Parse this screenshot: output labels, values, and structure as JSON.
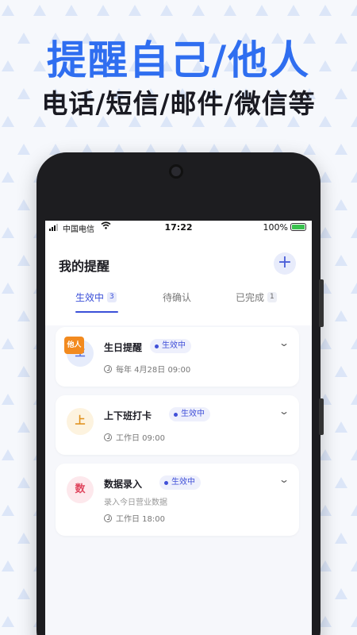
{
  "hero": {
    "title": "提醒自己/他人",
    "subtitle": "电话/短信/邮件/微信等"
  },
  "colors": {
    "accent": "#2f6ef0",
    "tab_active": "#3b50d8",
    "tag_orange": "#f28a1f"
  },
  "status_bar": {
    "carrier": "中国电信",
    "time": "17:22",
    "battery": "100%"
  },
  "page": {
    "title": "我的提醒",
    "add_icon": "plus-icon"
  },
  "tabs": [
    {
      "label": "生效中",
      "count": "3",
      "active": true
    },
    {
      "label": "待确认",
      "count": "",
      "active": false
    },
    {
      "label": "已完成",
      "count": "1",
      "active": false
    }
  ],
  "reminders": [
    {
      "icon_char": "生",
      "tag": "他人",
      "name": "生日提醒",
      "status": "生效中",
      "schedule": "每年 4月28日 09:00",
      "description": ""
    },
    {
      "icon_char": "上",
      "tag": "",
      "name": "上下班打卡",
      "status": "生效中",
      "schedule": "工作日 09:00",
      "description": ""
    },
    {
      "icon_char": "数",
      "tag": "",
      "name": "数据录入",
      "status": "生效中",
      "schedule": "工作日 18:00",
      "description": "录入今日营业数据"
    }
  ]
}
